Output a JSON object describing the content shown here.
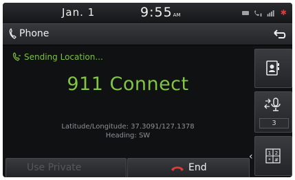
{
  "status_bar": {
    "date": "Jan.  1",
    "time": "9:55",
    "ampm": "AM"
  },
  "header": {
    "title": "Phone",
    "icons": [
      "phone-handset-icon",
      "back-arrow-icon"
    ]
  },
  "call": {
    "status": "Sending Location...",
    "label": "911 Connect",
    "lat_long": "Latitude/Longitude: 37.3091/127.1378",
    "heading": "Heading: SW"
  },
  "side_buttons": {
    "icons": [
      "contacts-icon",
      "mute-mic-icon",
      "keypad-icon"
    ],
    "mute_value": "3"
  },
  "bottom": {
    "use_private_label": "Use Private",
    "end_label": "End"
  },
  "colors": {
    "accent_green": "#7cc143",
    "end_red": "#e03c3c",
    "background": "#111214"
  }
}
